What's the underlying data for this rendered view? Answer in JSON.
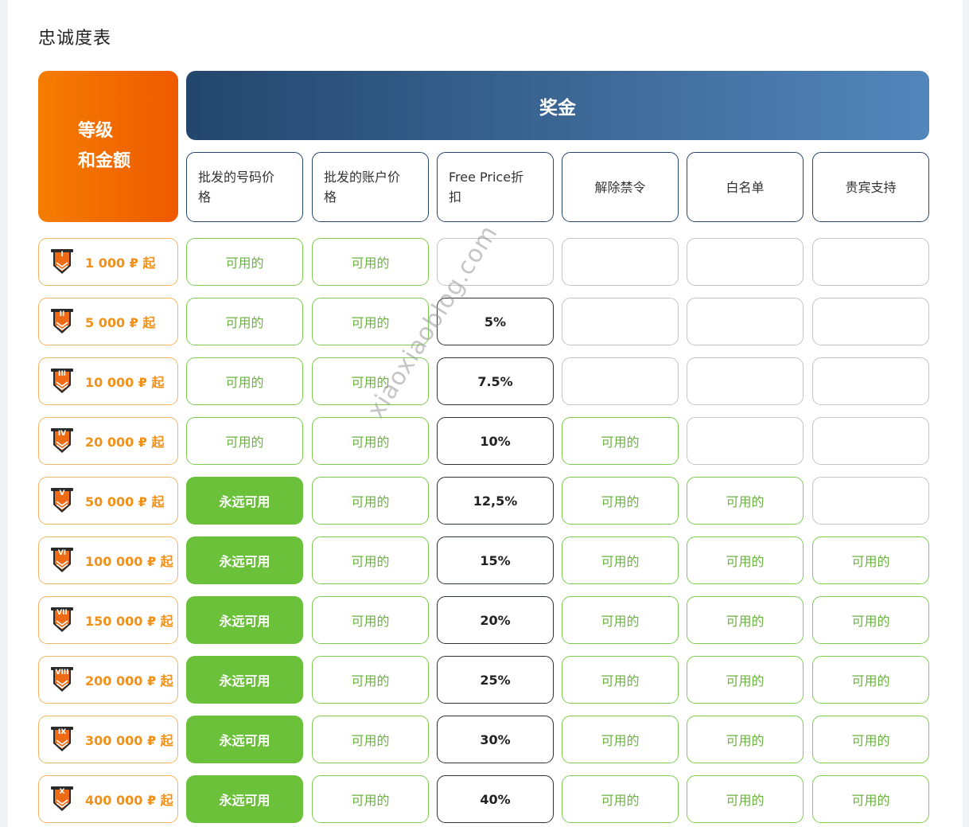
{
  "title": "忠诚度表",
  "header": {
    "level_line1": "等级",
    "level_line2": "和金额",
    "bonus": "奖金"
  },
  "columns": [
    {
      "l1": "批发的号码价",
      "l2": "格"
    },
    {
      "l1": "批发的账户价",
      "l2": "格"
    },
    {
      "l1": "Free Price折",
      "l2": "扣"
    },
    {
      "l1": "解除禁令",
      "l2": ""
    },
    {
      "l1": "白名单",
      "l2": ""
    },
    {
      "l1": "贵宾支持",
      "l2": ""
    }
  ],
  "rows": [
    {
      "num": "I",
      "amount": "1 000 ₽ 起",
      "cells": [
        [
          "avail",
          "可用的"
        ],
        [
          "avail",
          "可用的"
        ],
        [
          "empty",
          ""
        ],
        [
          "empty",
          ""
        ],
        [
          "empty",
          ""
        ],
        [
          "empty",
          ""
        ]
      ]
    },
    {
      "num": "II",
      "amount": "5 000 ₽ 起",
      "cells": [
        [
          "avail",
          "可用的"
        ],
        [
          "avail",
          "可用的"
        ],
        [
          "pct",
          "5%"
        ],
        [
          "empty",
          ""
        ],
        [
          "empty",
          ""
        ],
        [
          "empty",
          ""
        ]
      ]
    },
    {
      "num": "III",
      "amount": "10 000 ₽ 起",
      "cells": [
        [
          "avail",
          "可用的"
        ],
        [
          "avail",
          "可用的"
        ],
        [
          "pct",
          "7.5%"
        ],
        [
          "empty",
          ""
        ],
        [
          "empty",
          ""
        ],
        [
          "empty",
          ""
        ]
      ]
    },
    {
      "num": "IV",
      "amount": "20 000 ₽ 起",
      "cells": [
        [
          "avail",
          "可用的"
        ],
        [
          "avail",
          "可用的"
        ],
        [
          "pct",
          "10%"
        ],
        [
          "avail",
          "可用的"
        ],
        [
          "empty",
          ""
        ],
        [
          "empty",
          ""
        ]
      ]
    },
    {
      "num": "V",
      "amount": "50 000 ₽ 起",
      "cells": [
        [
          "forever",
          "永远可用"
        ],
        [
          "avail",
          "可用的"
        ],
        [
          "pct",
          "12,5%"
        ],
        [
          "avail",
          "可用的"
        ],
        [
          "avail",
          "可用的"
        ],
        [
          "empty",
          ""
        ]
      ]
    },
    {
      "num": "VI",
      "amount": "100 000 ₽ 起",
      "cells": [
        [
          "forever",
          "永远可用"
        ],
        [
          "avail",
          "可用的"
        ],
        [
          "pct",
          "15%"
        ],
        [
          "avail",
          "可用的"
        ],
        [
          "avail",
          "可用的"
        ],
        [
          "avail",
          "可用的"
        ]
      ]
    },
    {
      "num": "VII",
      "amount": "150 000 ₽ 起",
      "cells": [
        [
          "forever",
          "永远可用"
        ],
        [
          "avail",
          "可用的"
        ],
        [
          "pct",
          "20%"
        ],
        [
          "avail",
          "可用的"
        ],
        [
          "avail",
          "可用的"
        ],
        [
          "avail",
          "可用的"
        ]
      ]
    },
    {
      "num": "VIII",
      "amount": "200 000 ₽ 起",
      "cells": [
        [
          "forever",
          "永远可用"
        ],
        [
          "avail",
          "可用的"
        ],
        [
          "pct",
          "25%"
        ],
        [
          "avail",
          "可用的"
        ],
        [
          "avail",
          "可用的"
        ],
        [
          "avail",
          "可用的"
        ]
      ]
    },
    {
      "num": "IX",
      "amount": "300 000 ₽ 起",
      "cells": [
        [
          "forever",
          "永远可用"
        ],
        [
          "avail",
          "可用的"
        ],
        [
          "pct",
          "30%"
        ],
        [
          "avail",
          "可用的"
        ],
        [
          "avail",
          "可用的"
        ],
        [
          "avail",
          "可用的"
        ]
      ]
    },
    {
      "num": "X",
      "amount": "400 000 ₽ 起",
      "cells": [
        [
          "forever",
          "永远可用"
        ],
        [
          "avail",
          "可用的"
        ],
        [
          "pct",
          "40%"
        ],
        [
          "avail",
          "可用的"
        ],
        [
          "avail",
          "可用的"
        ],
        [
          "avail",
          "可用的"
        ]
      ]
    }
  ],
  "watermark": "xiaoxiaoblog.com",
  "colors": {
    "level_gradient": [
      "#f47d00",
      "#ef5a00"
    ],
    "bonus_gradient": [
      "#23466d",
      "#5386bb"
    ],
    "available_green": "#6ab23f",
    "forever_green": "#6bc13a",
    "level_orange": "#f29118"
  }
}
